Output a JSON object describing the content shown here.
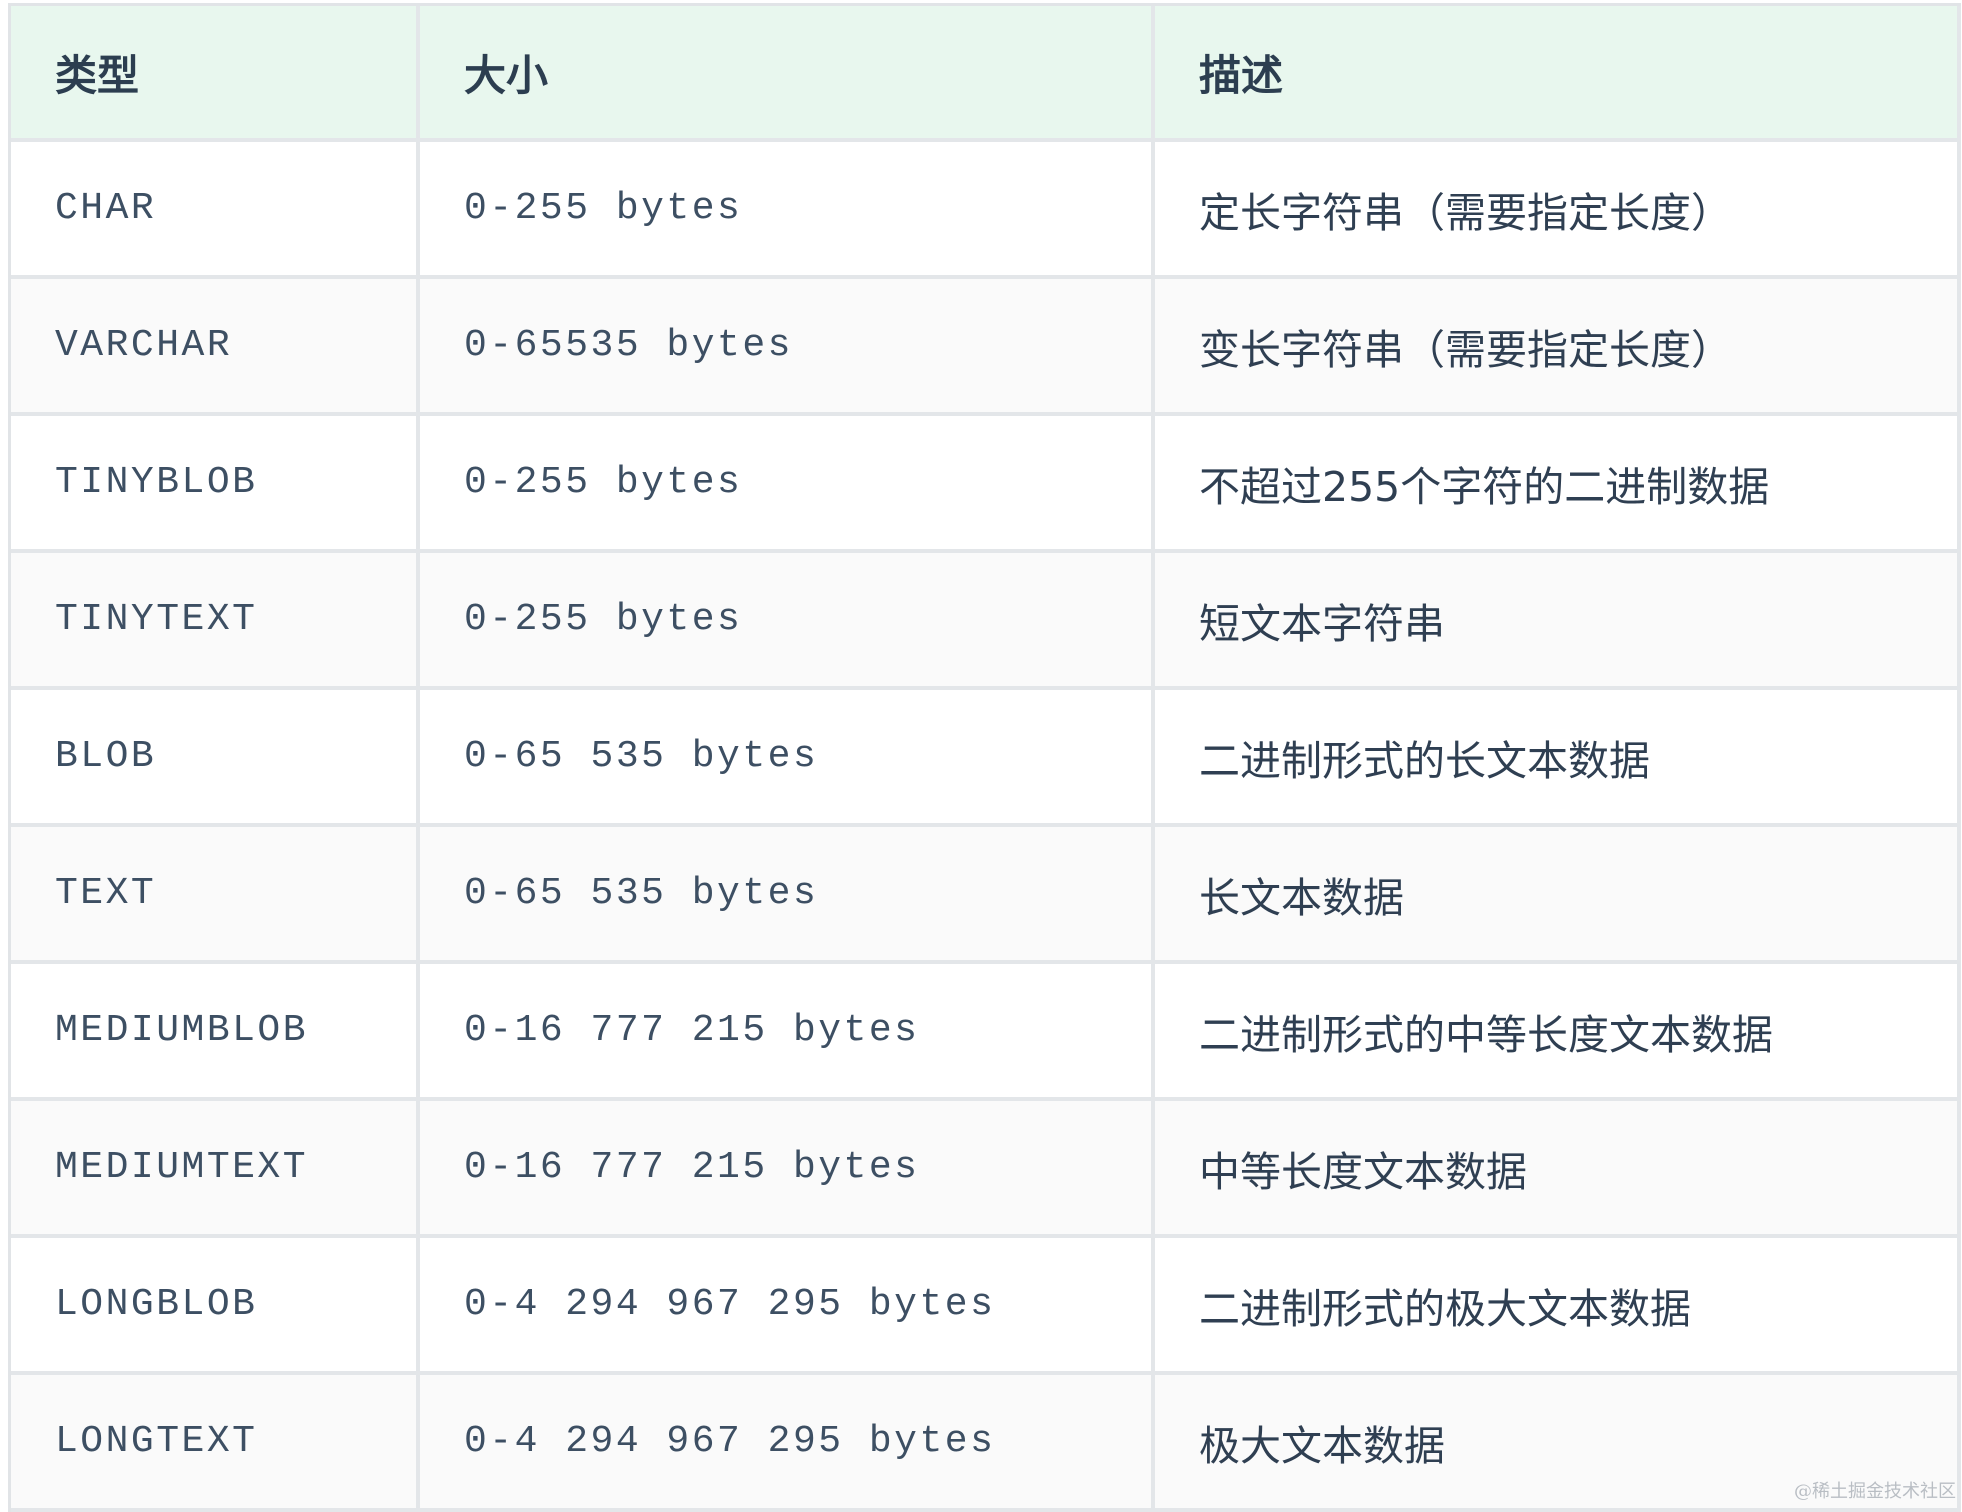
{
  "table": {
    "headers": [
      "类型",
      "大小",
      "描述"
    ],
    "rows": [
      {
        "type": "CHAR",
        "size": "0-255 bytes",
        "desc": "定长字符串（需要指定长度）"
      },
      {
        "type": "VARCHAR",
        "size": "0-65535 bytes",
        "desc": "变长字符串（需要指定长度）"
      },
      {
        "type": "TINYBLOB",
        "size": "0-255 bytes",
        "desc": "不超过255个字符的二进制数据"
      },
      {
        "type": "TINYTEXT",
        "size": "0-255 bytes",
        "desc": "短文本字符串"
      },
      {
        "type": "BLOB",
        "size": "0-65 535 bytes",
        "desc": "二进制形式的长文本数据"
      },
      {
        "type": "TEXT",
        "size": "0-65 535 bytes",
        "desc": "长文本数据"
      },
      {
        "type": "MEDIUMBLOB",
        "size": "0-16 777 215 bytes",
        "desc": "二进制形式的中等长度文本数据"
      },
      {
        "type": "MEDIUMTEXT",
        "size": "0-16 777 215 bytes",
        "desc": "中等长度文本数据"
      },
      {
        "type": "LONGBLOB",
        "size": "0-4 294 967 295 bytes",
        "desc": "二进制形式的极大文本数据"
      },
      {
        "type": "LONGTEXT",
        "size": "0-4 294 967 295 bytes",
        "desc": "极大文本数据"
      }
    ]
  },
  "watermark": "@稀土掘金技术社区"
}
